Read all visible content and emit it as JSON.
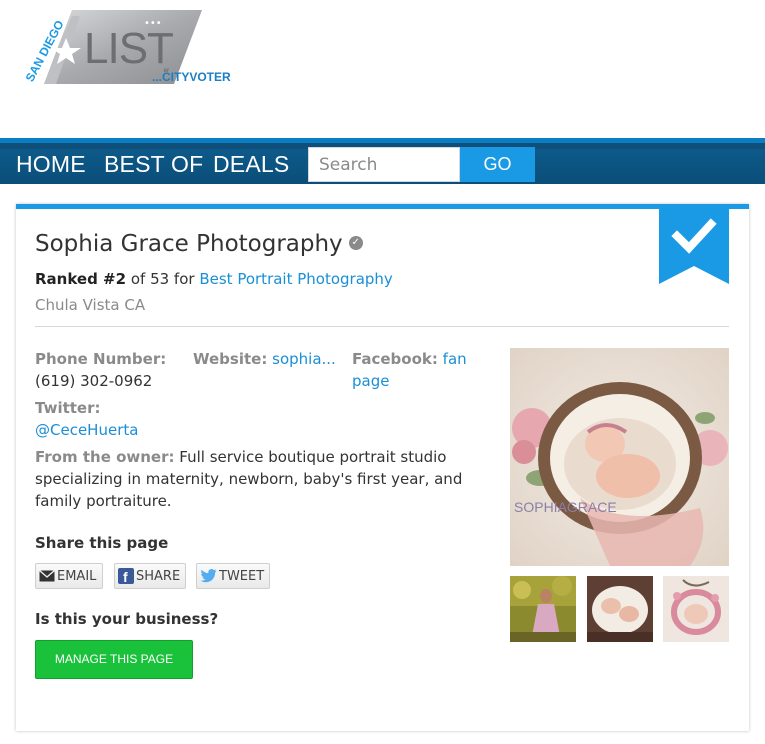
{
  "logo": {
    "region": "SAN DIEGO",
    "wordmark": "LIST",
    "byline": "BY",
    "brand": "...CITYVOTER"
  },
  "nav": {
    "items": [
      "HOME",
      "BEST OF",
      "DEALS"
    ],
    "search_placeholder": "Search",
    "search_value": "",
    "go_label": "GO"
  },
  "business": {
    "name": "Sophia Grace Photography",
    "rank_label": "Ranked #2",
    "rank_of": "of 53 for",
    "category": "Best Portrait Photography",
    "location": "Chula Vista CA",
    "phone_label": "Phone Number:",
    "phone": "(619) 302-0962",
    "website_label": "Website:",
    "website": "sophia...",
    "facebook_label": "Facebook:",
    "facebook_link": "fan page",
    "twitter_label": "Twitter:",
    "twitter": "@CeceHuerta",
    "owner_label": "From the owner:",
    "owner_text": "Full service boutique portrait studio specializing in maternity, newborn, baby's first year, and family portraiture."
  },
  "share": {
    "title": "Share this page",
    "email": "EMAIL",
    "share": "SHARE",
    "tweet": "TWEET"
  },
  "claim": {
    "title": "Is this your business?",
    "button": "MANAGE THIS PAGE"
  },
  "photo_watermark": "SOPHIAGRACE",
  "colors": {
    "nav_bg": "#0d5a8a",
    "accent_blue": "#1a9ae4",
    "link": "#1a8fd6",
    "manage_green": "#19c23a"
  }
}
